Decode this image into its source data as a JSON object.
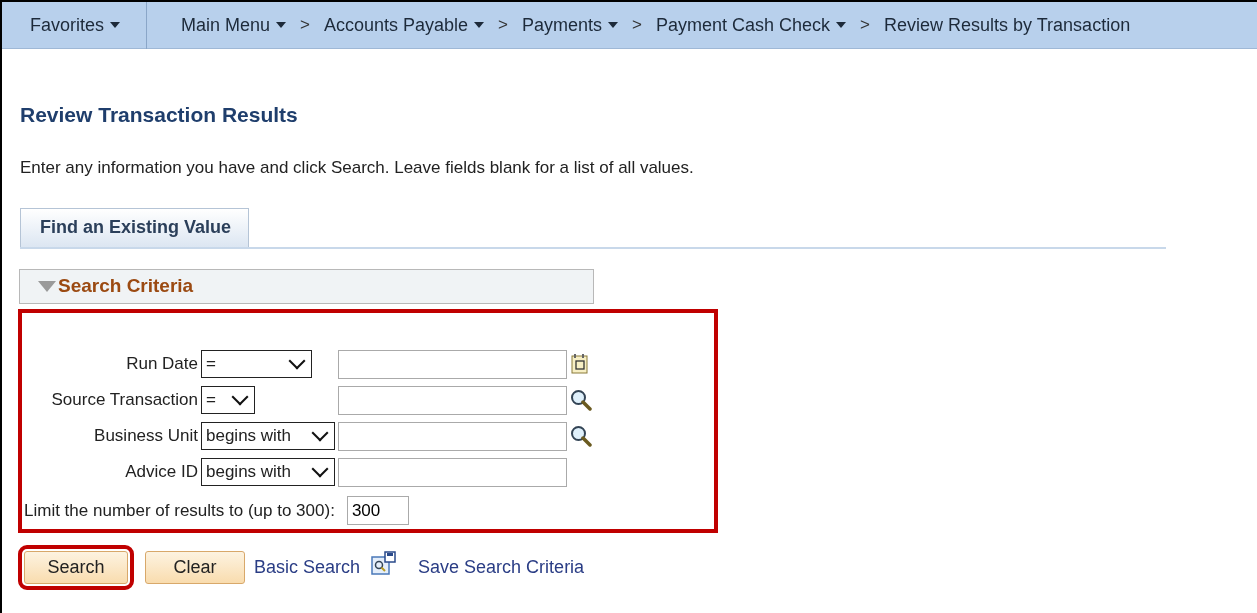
{
  "nav": [
    {
      "label": "Favorites",
      "dropdown": true
    },
    {
      "label": "Main Menu",
      "dropdown": true
    },
    {
      "label": "Accounts Payable",
      "separator": ">",
      "dropdown": true
    },
    {
      "label": "Payments",
      "separator": ">",
      "dropdown": true
    },
    {
      "label": "Payment Cash Check",
      "separator": ">",
      "dropdown": true
    },
    {
      "label": "Review Results by Transaction",
      "separator": ">",
      "dropdown": false
    }
  ],
  "page_title": "Review Transaction Results",
  "instructions": "Enter any information you have and click Search. Leave fields blank for a list of all values.",
  "tabs": [
    {
      "label": "Find an Existing Value",
      "selected": true
    }
  ],
  "search_criteria": {
    "title": "Search Criteria",
    "expanded": true,
    "highlighted": true,
    "fields": [
      {
        "label": "Run Date",
        "operator": "=",
        "kind": "date"
      },
      {
        "label": "Source Transaction",
        "operator": "=",
        "kind": "lookup"
      },
      {
        "label": "Business Unit",
        "operator": "begins with",
        "kind": "lookup"
      },
      {
        "label": "Advice ID",
        "operator": "begins with",
        "kind": "plain"
      }
    ],
    "limit": {
      "label": "Limit the number of results to (up to 300):",
      "value": "300"
    }
  },
  "actions": [
    {
      "kind": "button",
      "label": "Search",
      "highlighted": true
    },
    {
      "kind": "button",
      "label": "Clear",
      "highlighted": false
    },
    {
      "kind": "link",
      "label": "Basic Search"
    },
    {
      "kind": "icon"
    },
    {
      "kind": "link",
      "label": "Save Search Criteria"
    }
  ]
}
